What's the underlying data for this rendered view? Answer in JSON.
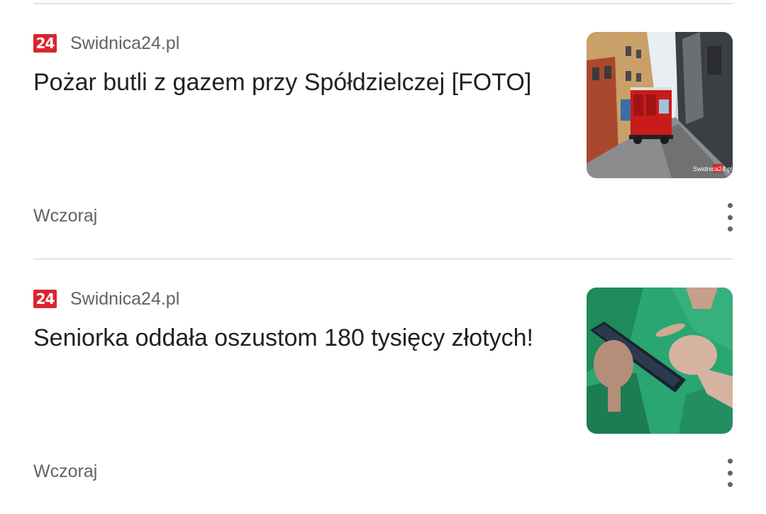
{
  "articles": [
    {
      "source": "Swidnica24.pl",
      "favicon_text": "24",
      "title": "Pożar butli z gazem przy Spółdzielczej [FOTO]",
      "time": "Wczoraj",
      "image_icon": "fire-truck-street-photo",
      "watermark": "Swidnica24.pl"
    },
    {
      "source": "Swidnica24.pl",
      "favicon_text": "24",
      "title": "Seniorka oddała oszustom 180 tysięcy złotych!",
      "time": "Wczoraj",
      "image_icon": "hands-holding-phone-photo"
    }
  ],
  "colors": {
    "favicon": "#d8262c",
    "secondary_text": "#5f6368",
    "primary_text": "#202124",
    "divider": "#e3e3e3"
  },
  "icons": {
    "more": "more-vert-icon"
  }
}
